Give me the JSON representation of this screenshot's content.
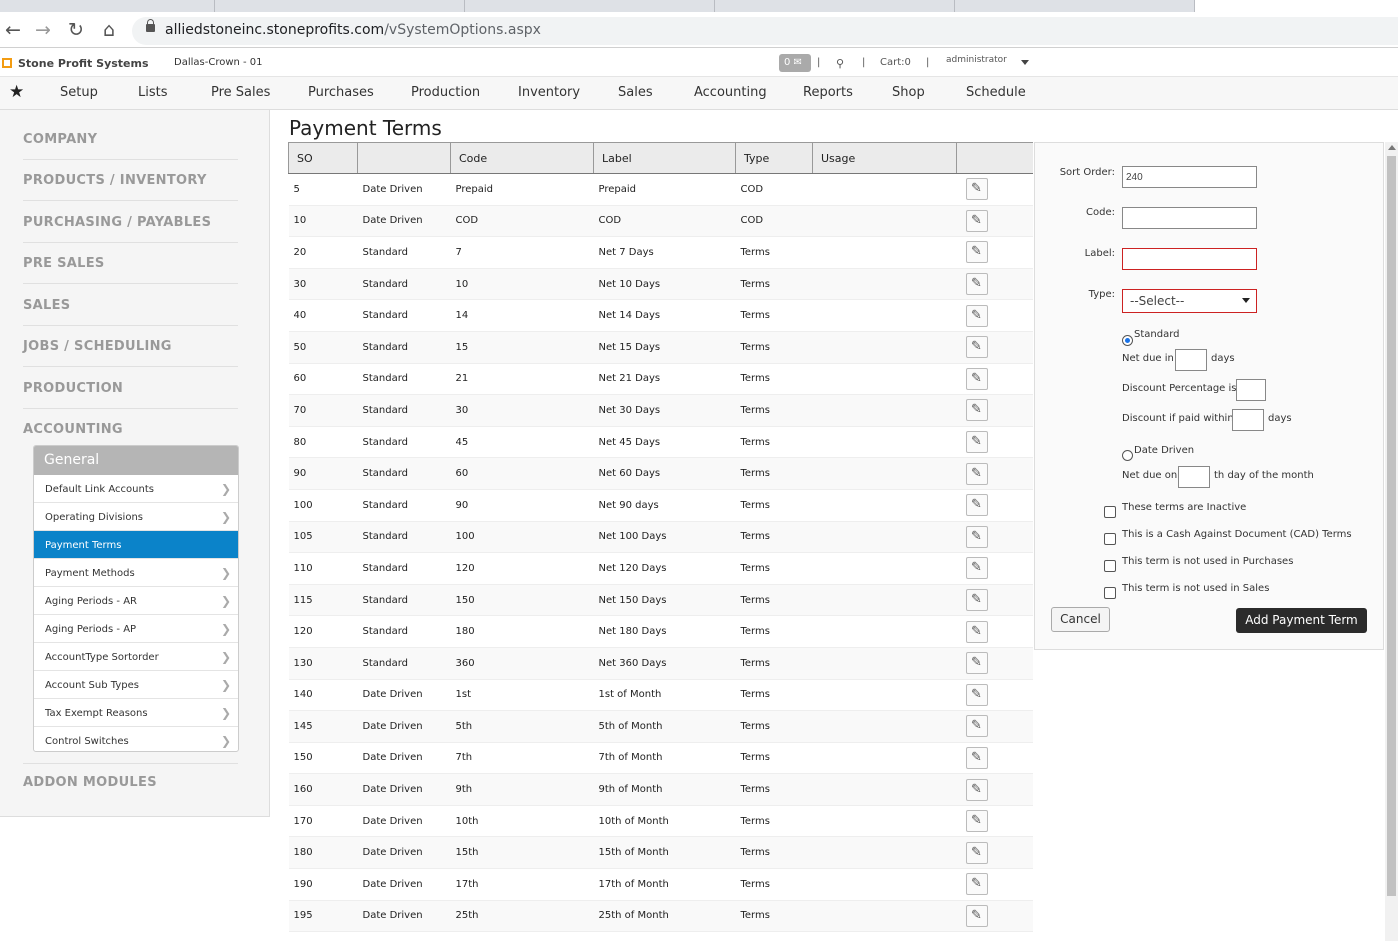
{
  "browser": {
    "url_host": "alliedstoneinc.stoneprofits.com",
    "url_path": "/vSystemOptions.aspx"
  },
  "header": {
    "brand": "Stone Profit Systems",
    "location": "Dallas-Crown - 01",
    "messages_count": "0",
    "cart": "Cart:0",
    "user": "administrator"
  },
  "menu": [
    "Setup",
    "Lists",
    "Pre Sales",
    "Purchases",
    "Production",
    "Inventory",
    "Sales",
    "Accounting",
    "Reports",
    "Shop",
    "Schedule"
  ],
  "sidebar": {
    "categories": [
      "COMPANY",
      "PRODUCTS / INVENTORY",
      "PURCHASING / PAYABLES",
      "PRE SALES",
      "SALES",
      "JOBS / SCHEDULING",
      "PRODUCTION",
      "ACCOUNTING"
    ],
    "panel_title": "General",
    "items": [
      "Default Link Accounts",
      "Operating Divisions",
      "Payment Terms",
      "Payment Methods",
      "Aging Periods - AR",
      "Aging Periods - AP",
      "AccountType Sortorder",
      "Account Sub Types",
      "Tax Exempt Reasons",
      "Control Switches"
    ],
    "selected_item": "Payment Terms",
    "addon": "ADDON MODULES"
  },
  "page": {
    "title": "Payment Terms"
  },
  "table": {
    "headers": [
      "SO",
      "",
      "Code",
      "Label",
      "Type",
      "Usage",
      ""
    ],
    "rows": [
      [
        "5",
        "Date Driven",
        "Prepaid",
        "Prepaid",
        "COD"
      ],
      [
        "10",
        "Date Driven",
        "COD",
        "COD",
        "COD"
      ],
      [
        "20",
        "Standard",
        "7",
        "Net 7 Days",
        "Terms"
      ],
      [
        "30",
        "Standard",
        "10",
        "Net 10 Days",
        "Terms"
      ],
      [
        "40",
        "Standard",
        "14",
        "Net 14 Days",
        "Terms"
      ],
      [
        "50",
        "Standard",
        "15",
        "Net 15 Days",
        "Terms"
      ],
      [
        "60",
        "Standard",
        "21",
        "Net 21 Days",
        "Terms"
      ],
      [
        "70",
        "Standard",
        "30",
        "Net 30 Days",
        "Terms"
      ],
      [
        "80",
        "Standard",
        "45",
        "Net 45 Days",
        "Terms"
      ],
      [
        "90",
        "Standard",
        "60",
        "Net 60 Days",
        "Terms"
      ],
      [
        "100",
        "Standard",
        "90",
        "Net 90 days",
        "Terms"
      ],
      [
        "105",
        "Standard",
        "100",
        "Net 100 Days",
        "Terms"
      ],
      [
        "110",
        "Standard",
        "120",
        "Net 120 Days",
        "Terms"
      ],
      [
        "115",
        "Standard",
        "150",
        "Net 150 Days",
        "Terms"
      ],
      [
        "120",
        "Standard",
        "180",
        "Net 180 Days",
        "Terms"
      ],
      [
        "130",
        "Standard",
        "360",
        "Net 360 Days",
        "Terms"
      ],
      [
        "140",
        "Date Driven",
        "1st",
        "1st of Month",
        "Terms"
      ],
      [
        "145",
        "Date Driven",
        "5th",
        "5th of Month",
        "Terms"
      ],
      [
        "150",
        "Date Driven",
        "7th",
        "7th of Month",
        "Terms"
      ],
      [
        "160",
        "Date Driven",
        "9th",
        "9th of Month",
        "Terms"
      ],
      [
        "170",
        "Date Driven",
        "10th",
        "10th of Month",
        "Terms"
      ],
      [
        "180",
        "Date Driven",
        "15th",
        "15th of Month",
        "Terms"
      ],
      [
        "190",
        "Date Driven",
        "17th",
        "17th of Month",
        "Terms"
      ],
      [
        "195",
        "Date Driven",
        "25th",
        "25th of Month",
        "Terms"
      ]
    ]
  },
  "form": {
    "sort_order_label": "Sort Order:",
    "sort_order_value": "240",
    "code_label": "Code:",
    "label_label": "Label:",
    "type_label": "Type:",
    "type_value": "--Select--",
    "standard_label": "Standard",
    "net_due_in": "Net due in",
    "days": "days",
    "discount_pct": "Discount Percentage is",
    "discount_within": "Discount if paid within",
    "date_driven_label": "Date Driven",
    "net_due_on": "Net due on",
    "th_day": "th day of the month",
    "chk_inactive": "These terms are Inactive",
    "chk_cad": "This is a Cash Against Document (CAD) Terms",
    "chk_purchases": "This term is not used in Purchases",
    "chk_sales": "This term is not used in Sales",
    "cancel": "Cancel",
    "add": "Add Payment Term"
  },
  "colors": {
    "selected": "#0b83c9",
    "error": "#cc2222",
    "brand": "#f39c12"
  }
}
